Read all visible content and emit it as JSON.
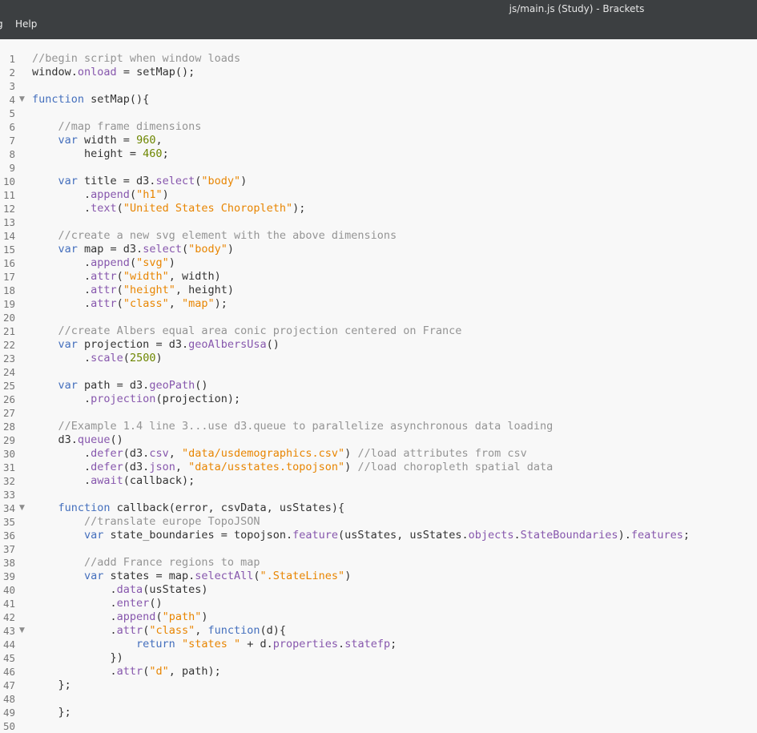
{
  "window": {
    "title": "js/main.js (Study) - Brackets"
  },
  "menu": {
    "items": [
      "g",
      "Help"
    ]
  },
  "editor": {
    "lines": [
      [
        [
          "c",
          "//begin script when window loads"
        ]
      ],
      [
        [
          "",
          "window."
        ],
        [
          "p",
          "onload"
        ],
        [
          "",
          " = setMap();"
        ]
      ],
      [],
      [
        [
          "k",
          "function"
        ],
        [
          "",
          " setMap(){"
        ]
      ],
      [],
      [
        [
          "",
          "    "
        ],
        [
          "c",
          "//map frame dimensions"
        ]
      ],
      [
        [
          "",
          "    "
        ],
        [
          "k",
          "var"
        ],
        [
          "",
          " width = "
        ],
        [
          "n",
          "960"
        ],
        [
          "",
          ","
        ]
      ],
      [
        [
          "",
          "        height = "
        ],
        [
          "n",
          "460"
        ],
        [
          "",
          ";"
        ]
      ],
      [],
      [
        [
          "",
          "    "
        ],
        [
          "k",
          "var"
        ],
        [
          "",
          " title = d3."
        ],
        [
          "p",
          "select"
        ],
        [
          "",
          "("
        ],
        [
          "s",
          "\"body\""
        ],
        [
          "",
          ")"
        ]
      ],
      [
        [
          "",
          "        ."
        ],
        [
          "p",
          "append"
        ],
        [
          "",
          "("
        ],
        [
          "s",
          "\"h1\""
        ],
        [
          "",
          ")"
        ]
      ],
      [
        [
          "",
          "        ."
        ],
        [
          "p",
          "text"
        ],
        [
          "",
          "("
        ],
        [
          "s",
          "\"United States Choropleth\""
        ],
        [
          "",
          ");"
        ]
      ],
      [],
      [
        [
          "",
          "    "
        ],
        [
          "c",
          "//create a new svg element with the above dimensions"
        ]
      ],
      [
        [
          "",
          "    "
        ],
        [
          "k",
          "var"
        ],
        [
          "",
          " map = d3."
        ],
        [
          "p",
          "select"
        ],
        [
          "",
          "("
        ],
        [
          "s",
          "\"body\""
        ],
        [
          "",
          ")"
        ]
      ],
      [
        [
          "",
          "        ."
        ],
        [
          "p",
          "append"
        ],
        [
          "",
          "("
        ],
        [
          "s",
          "\"svg\""
        ],
        [
          "",
          ")"
        ]
      ],
      [
        [
          "",
          "        ."
        ],
        [
          "p",
          "attr"
        ],
        [
          "",
          "("
        ],
        [
          "s",
          "\"width\""
        ],
        [
          "",
          ", width)"
        ]
      ],
      [
        [
          "",
          "        ."
        ],
        [
          "p",
          "attr"
        ],
        [
          "",
          "("
        ],
        [
          "s",
          "\"height\""
        ],
        [
          "",
          ", height)"
        ]
      ],
      [
        [
          "",
          "        ."
        ],
        [
          "p",
          "attr"
        ],
        [
          "",
          "("
        ],
        [
          "s",
          "\"class\""
        ],
        [
          "",
          ", "
        ],
        [
          "s",
          "\"map\""
        ],
        [
          "",
          ");"
        ]
      ],
      [],
      [
        [
          "",
          "    "
        ],
        [
          "c",
          "//create Albers equal area conic projection centered on France"
        ]
      ],
      [
        [
          "",
          "    "
        ],
        [
          "k",
          "var"
        ],
        [
          "",
          " projection = d3."
        ],
        [
          "p",
          "geoAlbersUsa"
        ],
        [
          "",
          "()"
        ]
      ],
      [
        [
          "",
          "        ."
        ],
        [
          "p",
          "scale"
        ],
        [
          "",
          "("
        ],
        [
          "n",
          "2500"
        ],
        [
          "",
          ")"
        ]
      ],
      [],
      [
        [
          "",
          "    "
        ],
        [
          "k",
          "var"
        ],
        [
          "",
          " path = d3."
        ],
        [
          "p",
          "geoPath"
        ],
        [
          "",
          "()"
        ]
      ],
      [
        [
          "",
          "        ."
        ],
        [
          "p",
          "projection"
        ],
        [
          "",
          "(projection);"
        ]
      ],
      [],
      [
        [
          "",
          "    "
        ],
        [
          "c",
          "//Example 1.4 line 3...use d3.queue to parallelize asynchronous data loading"
        ]
      ],
      [
        [
          "",
          "    d3."
        ],
        [
          "p",
          "queue"
        ],
        [
          "",
          "()"
        ]
      ],
      [
        [
          "",
          "        ."
        ],
        [
          "p",
          "defer"
        ],
        [
          "",
          "(d3."
        ],
        [
          "p",
          "csv"
        ],
        [
          "",
          ", "
        ],
        [
          "s",
          "\"data/usdemographics.csv\""
        ],
        [
          "",
          ") "
        ],
        [
          "c",
          "//load attributes from csv"
        ]
      ],
      [
        [
          "",
          "        ."
        ],
        [
          "p",
          "defer"
        ],
        [
          "",
          "(d3."
        ],
        [
          "p",
          "json"
        ],
        [
          "",
          ", "
        ],
        [
          "s",
          "\"data/usstates.topojson\""
        ],
        [
          "",
          ") "
        ],
        [
          "c",
          "//load choropleth spatial data"
        ]
      ],
      [
        [
          "",
          "        ."
        ],
        [
          "p",
          "await"
        ],
        [
          "",
          "(callback);"
        ]
      ],
      [],
      [
        [
          "",
          "    "
        ],
        [
          "k",
          "function"
        ],
        [
          "",
          " callback(error, csvData, usStates){"
        ]
      ],
      [
        [
          "",
          "        "
        ],
        [
          "c",
          "//translate europe TopoJSON"
        ]
      ],
      [
        [
          "",
          "        "
        ],
        [
          "k",
          "var"
        ],
        [
          "",
          " state_boundaries = topojson."
        ],
        [
          "p",
          "feature"
        ],
        [
          "",
          "(usStates, usStates."
        ],
        [
          "p",
          "objects"
        ],
        [
          "",
          "."
        ],
        [
          "p",
          "StateBoundaries"
        ],
        [
          "",
          ")."
        ],
        [
          "p",
          "features"
        ],
        [
          "",
          ";"
        ]
      ],
      [],
      [
        [
          "",
          "        "
        ],
        [
          "c",
          "//add France regions to map"
        ]
      ],
      [
        [
          "",
          "        "
        ],
        [
          "k",
          "var"
        ],
        [
          "",
          " states = map."
        ],
        [
          "p",
          "selectAll"
        ],
        [
          "",
          "("
        ],
        [
          "s",
          "\".StateLines\""
        ],
        [
          "",
          ")"
        ]
      ],
      [
        [
          "",
          "            ."
        ],
        [
          "p",
          "data"
        ],
        [
          "",
          "(usStates)"
        ]
      ],
      [
        [
          "",
          "            ."
        ],
        [
          "p",
          "enter"
        ],
        [
          "",
          "()"
        ]
      ],
      [
        [
          "",
          "            ."
        ],
        [
          "p",
          "append"
        ],
        [
          "",
          "("
        ],
        [
          "s",
          "\"path\""
        ],
        [
          "",
          ")"
        ]
      ],
      [
        [
          "",
          "            ."
        ],
        [
          "p",
          "attr"
        ],
        [
          "",
          "("
        ],
        [
          "s",
          "\"class\""
        ],
        [
          "",
          ", "
        ],
        [
          "k",
          "function"
        ],
        [
          "",
          "(d){"
        ]
      ],
      [
        [
          "",
          "                "
        ],
        [
          "k",
          "return"
        ],
        [
          "",
          " "
        ],
        [
          "s",
          "\"states \""
        ],
        [
          "",
          " + d."
        ],
        [
          "p",
          "properties"
        ],
        [
          "",
          "."
        ],
        [
          "p",
          "statefp"
        ],
        [
          "",
          ";"
        ]
      ],
      [
        [
          "",
          "            })"
        ]
      ],
      [
        [
          "",
          "            ."
        ],
        [
          "p",
          "attr"
        ],
        [
          "",
          "("
        ],
        [
          "s",
          "\"d\""
        ],
        [
          "",
          ", path);"
        ]
      ],
      [
        [
          "",
          "    };"
        ]
      ],
      [],
      [
        [
          "",
          "    };"
        ]
      ],
      []
    ],
    "fold_lines": [
      4,
      34,
      43
    ],
    "first_line_number": 1
  },
  "colors": {
    "background": "#f8f8f8",
    "titlebar": "#3c3f41",
    "comment": "#949494",
    "keyword": "#446fbd",
    "string": "#e88501",
    "number": "#6d8600",
    "property": "#8757ad",
    "text": "#333333",
    "line_number": "#767676"
  },
  "icons": {
    "fold_marker": "fold-triangle-icon"
  }
}
